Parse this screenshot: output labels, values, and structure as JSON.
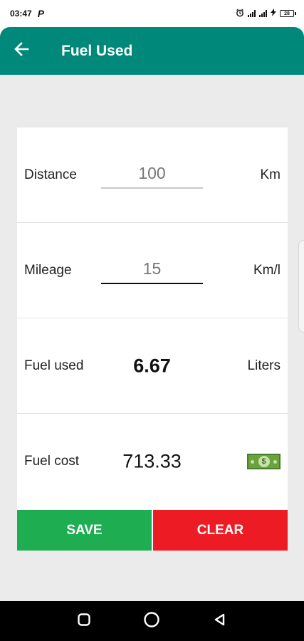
{
  "status_bar": {
    "time": "03:47",
    "notification_glyph": "P",
    "battery_level": "28",
    "icons": [
      "alarm-icon",
      "signal-icon",
      "signal-icon",
      "charging-icon",
      "battery-icon"
    ]
  },
  "app_bar": {
    "title": "Fuel Used",
    "back_icon": "back-arrow-icon",
    "background_color": "#00897b"
  },
  "form": {
    "distance": {
      "label": "Distance",
      "value": "100",
      "unit": "Km"
    },
    "mileage": {
      "label": "Mileage",
      "value": "15",
      "unit": "Km/l"
    },
    "fuel_used": {
      "label": "Fuel used",
      "value": "6.67",
      "unit": "Liters"
    },
    "fuel_cost": {
      "label": "Fuel cost",
      "value": "713.33",
      "unit_icon": "money-icon"
    }
  },
  "actions": {
    "save_label": "SAVE",
    "clear_label": "CLEAR",
    "save_color": "#1fad52",
    "clear_color": "#ed1c24"
  },
  "nav_bar": {
    "icons": [
      "recents-icon",
      "home-icon",
      "back-icon"
    ]
  }
}
